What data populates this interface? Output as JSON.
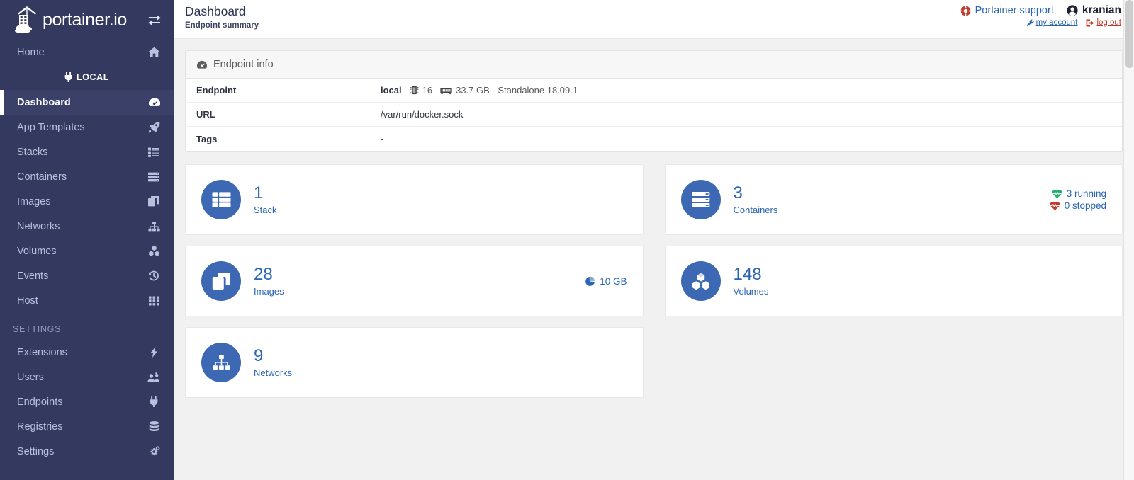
{
  "brand": {
    "name": "portainer.io",
    "logo_icon": "portainer-whale-crane-logo",
    "toggle_icon": "exchange-arrows-icon"
  },
  "sidebar": {
    "home": {
      "label": "Home",
      "icon": "home-icon"
    },
    "endpoint_divider": {
      "label": "LOCAL",
      "icon": "plug-icon"
    },
    "items": [
      {
        "label": "Dashboard",
        "icon": "tachometer-icon",
        "active": true
      },
      {
        "label": "App Templates",
        "icon": "rocket-icon",
        "active": false
      },
      {
        "label": "Stacks",
        "icon": "list-icon",
        "active": false
      },
      {
        "label": "Containers",
        "icon": "server-icon",
        "active": false
      },
      {
        "label": "Images",
        "icon": "clone-icon",
        "active": false
      },
      {
        "label": "Networks",
        "icon": "sitemap-icon",
        "active": false
      },
      {
        "label": "Volumes",
        "icon": "cubes-icon",
        "active": false
      },
      {
        "label": "Events",
        "icon": "history-icon",
        "active": false
      },
      {
        "label": "Host",
        "icon": "th-icon",
        "active": false
      }
    ],
    "settings_section": {
      "title": "SETTINGS",
      "items": [
        {
          "label": "Extensions",
          "icon": "bolt-icon"
        },
        {
          "label": "Users",
          "icon": "users-icon"
        },
        {
          "label": "Endpoints",
          "icon": "plug-icon"
        },
        {
          "label": "Registries",
          "icon": "database-icon"
        },
        {
          "label": "Settings",
          "icon": "cogs-icon"
        }
      ]
    }
  },
  "header": {
    "title": "Dashboard",
    "subtitle": "Endpoint summary",
    "support_label": "Portainer support",
    "support_icon": "life-ring-icon",
    "user_name": "kranian",
    "user_icon": "user-circle-icon",
    "my_account_label": "my account",
    "my_account_icon": "wrench-icon",
    "logout_label": "log out",
    "logout_icon": "sign-out-icon"
  },
  "endpoint_info": {
    "panel_title": "Endpoint info",
    "panel_icon": "tachometer-icon",
    "rows": [
      {
        "label": "Endpoint",
        "value_name": "local",
        "cpu_icon": "microchip-icon",
        "cpu_value": "16",
        "memory_icon": "memory-icon",
        "memory_value": "33.7 GB - Standalone 18.09.1"
      },
      {
        "label": "URL",
        "value": "/var/run/docker.sock"
      },
      {
        "label": "Tags",
        "value": "-"
      }
    ]
  },
  "cards": {
    "left_column": [
      {
        "count": "1",
        "label": "Stack",
        "icon": "stack-list-icon",
        "accent": "#3d68b3"
      },
      {
        "count": "28",
        "label": "Images",
        "icon": "clone-icon",
        "accent": "#3d68b3",
        "side": [
          {
            "icon": "pie-chart-icon",
            "text": "10 GB",
            "color": "#2a65b5"
          }
        ]
      },
      {
        "count": "9",
        "label": "Networks",
        "icon": "sitemap-icon",
        "accent": "#3d68b3"
      }
    ],
    "right_column": [
      {
        "count": "3",
        "label": "Containers",
        "icon": "server-icon",
        "accent": "#3d68b3",
        "side": [
          {
            "icon": "heartbeat-icon",
            "text": "3 running",
            "color": "#23ae6e"
          },
          {
            "icon": "heartbeat-icon",
            "text": "0 stopped",
            "color": "#c0392b"
          }
        ]
      },
      {
        "count": "148",
        "label": "Volumes",
        "icon": "cubes-icon",
        "accent": "#3d68b3"
      }
    ]
  },
  "theme": {
    "sidebar_bg": "#343a5f",
    "sidebar_active_bg": "#3a4068",
    "content_bg": "#f1f1f1",
    "accent_blue": "#2a65b5",
    "badge_blue": "#3d68b3",
    "green": "#23ae6e",
    "red": "#c0392b"
  }
}
